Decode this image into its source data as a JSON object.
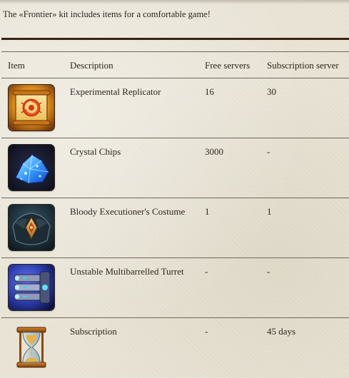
{
  "intro_text": "The «Frontier» kit includes items for a comfortable game!",
  "table": {
    "headers": {
      "item": "Item",
      "description": "Description",
      "free": "Free servers",
      "subscription": "Subscription server"
    },
    "rows": [
      {
        "icon": "replicator-scroll-icon",
        "description": "Experimental Replicator",
        "free": "16",
        "subscription": "30"
      },
      {
        "icon": "crystal-chips-icon",
        "description": "Crystal Chips",
        "free": "3000",
        "subscription": "-"
      },
      {
        "icon": "executioner-costume-icon",
        "description": "Bloody Executioner's Costume",
        "free": "1",
        "subscription": "1"
      },
      {
        "icon": "multibarrelled-turret-icon",
        "description": "Unstable Multibarrelled Turret",
        "free": "-",
        "subscription": "-"
      },
      {
        "icon": "hourglass-icon",
        "description": "Subscription",
        "free": "-",
        "subscription": "45 days"
      }
    ]
  },
  "colors": {
    "background": "#e9e4d6",
    "rule_dark": "#3a2314",
    "rule_line": "#6f685c",
    "text": "#2f261d"
  }
}
